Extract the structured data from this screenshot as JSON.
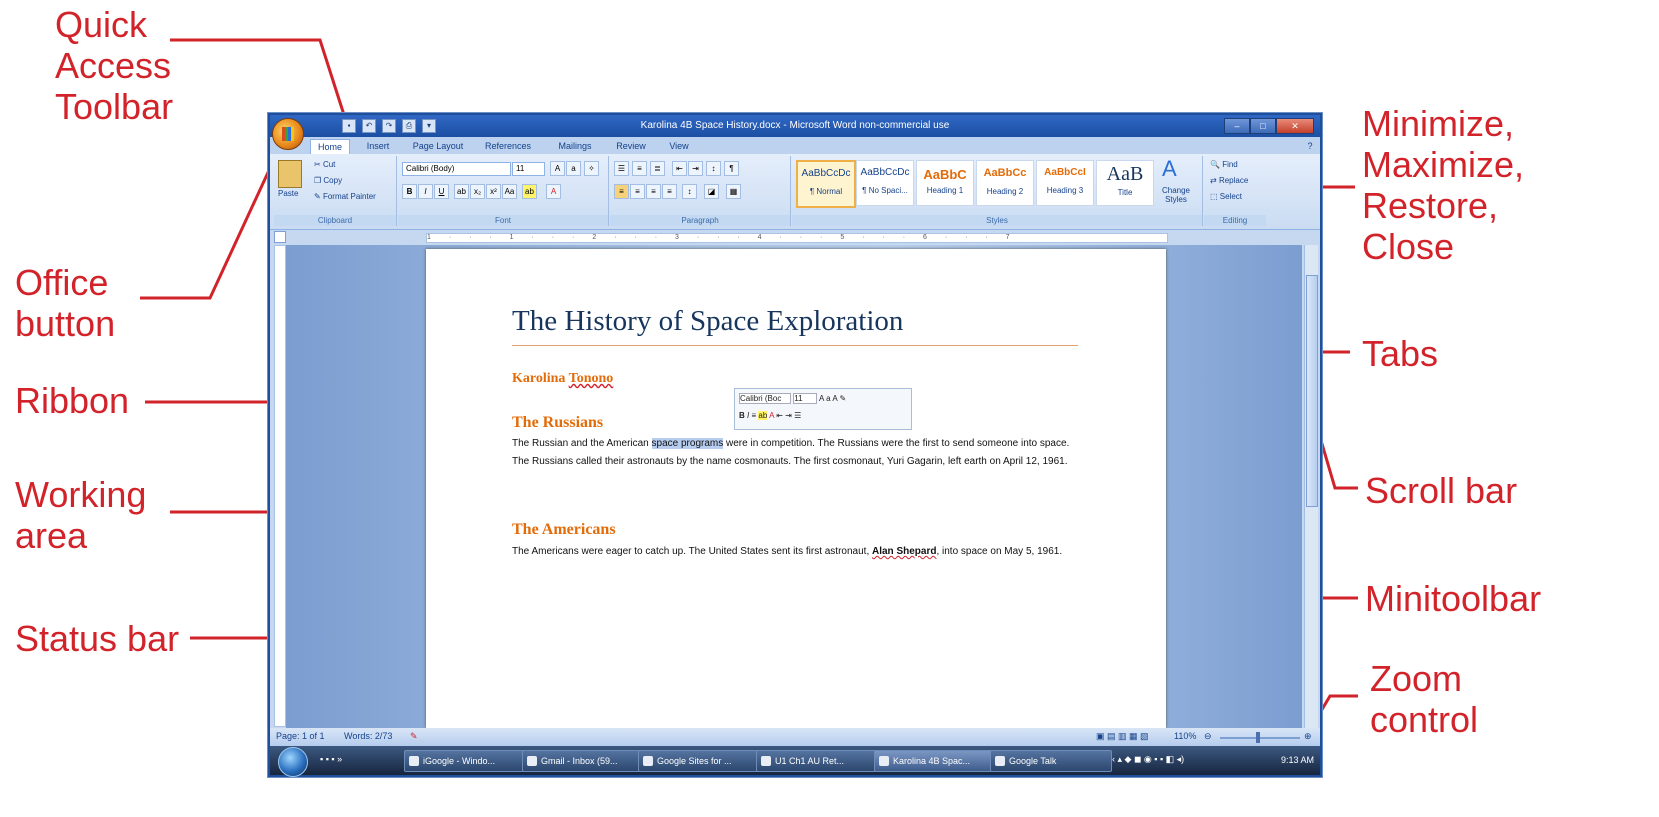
{
  "callouts": {
    "quick_access": "Quick\nAccess\nToolbar",
    "office_button": "Office\nbutton",
    "ribbon": "Ribbon",
    "working_area": "Working\narea",
    "status_bar": "Status bar",
    "window_controls": "Minimize,\nMaximize,\nRestore,\nClose",
    "tabs": "Tabs",
    "scroll_bar": "Scroll bar",
    "minitoolbar": "Minitoolbar",
    "zoom_control": "Zoom\ncontrol"
  },
  "window": {
    "title": "Karolina 4B Space History.docx - Microsoft Word non-commercial use"
  },
  "tabs": [
    "Home",
    "Insert",
    "Page Layout",
    "References",
    "Mailings",
    "Review",
    "View"
  ],
  "ribbon": {
    "clipboard": {
      "paste": "Paste",
      "cut": "Cut",
      "copy": "Copy",
      "format_painter": "Format Painter",
      "label": "Clipboard"
    },
    "font": {
      "name": "Calibri (Body)",
      "size": "11",
      "label": "Font"
    },
    "paragraph": {
      "label": "Paragraph"
    },
    "styles": {
      "items": [
        {
          "preview": "AaBbCcDc",
          "name": "¶ Normal"
        },
        {
          "preview": "AaBbCcDc",
          "name": "¶ No Spaci..."
        },
        {
          "preview": "AaBbC",
          "name": "Heading 1"
        },
        {
          "preview": "AaBbCc",
          "name": "Heading 2"
        },
        {
          "preview": "AaBbCcI",
          "name": "Heading 3"
        },
        {
          "preview": "AaB",
          "name": "Title"
        }
      ],
      "change_styles": "Change Styles",
      "label": "Styles"
    },
    "editing": {
      "find": "Find",
      "replace": "Replace",
      "select": "Select",
      "label": "Editing"
    }
  },
  "ruler_marks": "1 · · · 1 · · · 2 · · · 3 · · · 4 · · · 5 · · · 6 · · · 7",
  "document": {
    "title": "The History of Space Exploration",
    "author_first": "Karolina",
    "author_last": "Tonono",
    "h1": "The Russians",
    "p1_pre": "The Russian and the American ",
    "p1_hl": "space programs",
    "p1_post": " were in competition.  The Russians were the first to send someone into space.  The Russians called their astronauts by the name cosmonauts.  The first cosmonaut, Yuri Gagarin, left earth on April 12, 1961.",
    "h2": "The Americans",
    "p2_pre": "The Americans were eager to catch up.  The United States sent its first astronaut, ",
    "p2_bold": "Alan Shepard",
    "p2_post": ", into space on May 5, 1961."
  },
  "minitoolbar": {
    "font": "Calibri (Boc",
    "size": "11"
  },
  "statusbar": {
    "page": "Page: 1 of 1",
    "words": "Words: 2/73",
    "zoom": "110%"
  },
  "taskbar": {
    "buttons": [
      "iGoogle - Windo...",
      "Gmail - Inbox (59...",
      "Google Sites for ...",
      "U1 Ch1 AU Ret...",
      "Karolina 4B Spac...",
      "Google Talk"
    ],
    "time": "9:13 AM"
  }
}
